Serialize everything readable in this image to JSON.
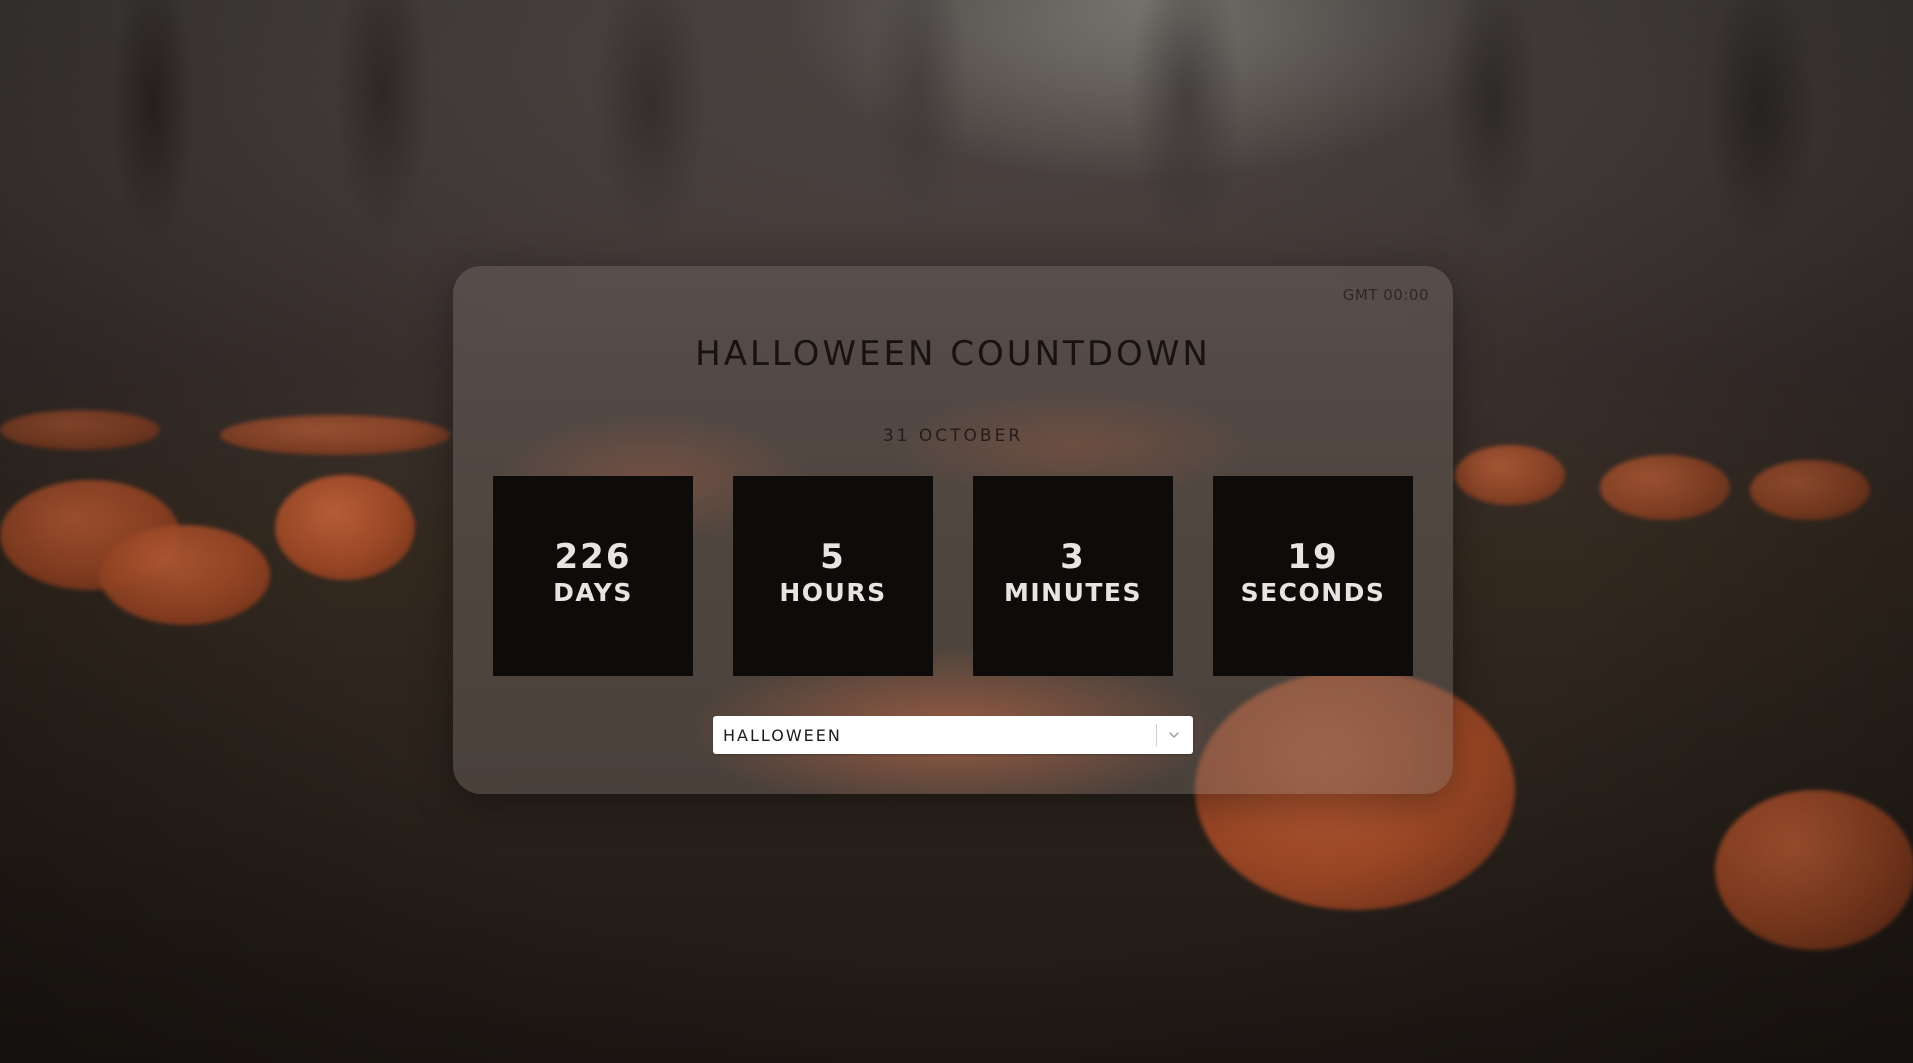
{
  "header": {
    "timezone": "GMT 00:00",
    "title": "HALLOWEEN COUNTDOWN",
    "date": "31 OCTOBER"
  },
  "countdown": [
    {
      "value": "226",
      "unit": "DAYS"
    },
    {
      "value": "5",
      "unit": "HOURS"
    },
    {
      "value": "3",
      "unit": "MINUTES"
    },
    {
      "value": "19",
      "unit": "SECONDS"
    }
  ],
  "event_select": {
    "selected": "HALLOWEEN",
    "icon": "chevron-down-icon"
  },
  "colors": {
    "box_background": "#0e0c0b",
    "box_text": "#e9e4e0",
    "accent_pumpkin": "#c8643a"
  }
}
